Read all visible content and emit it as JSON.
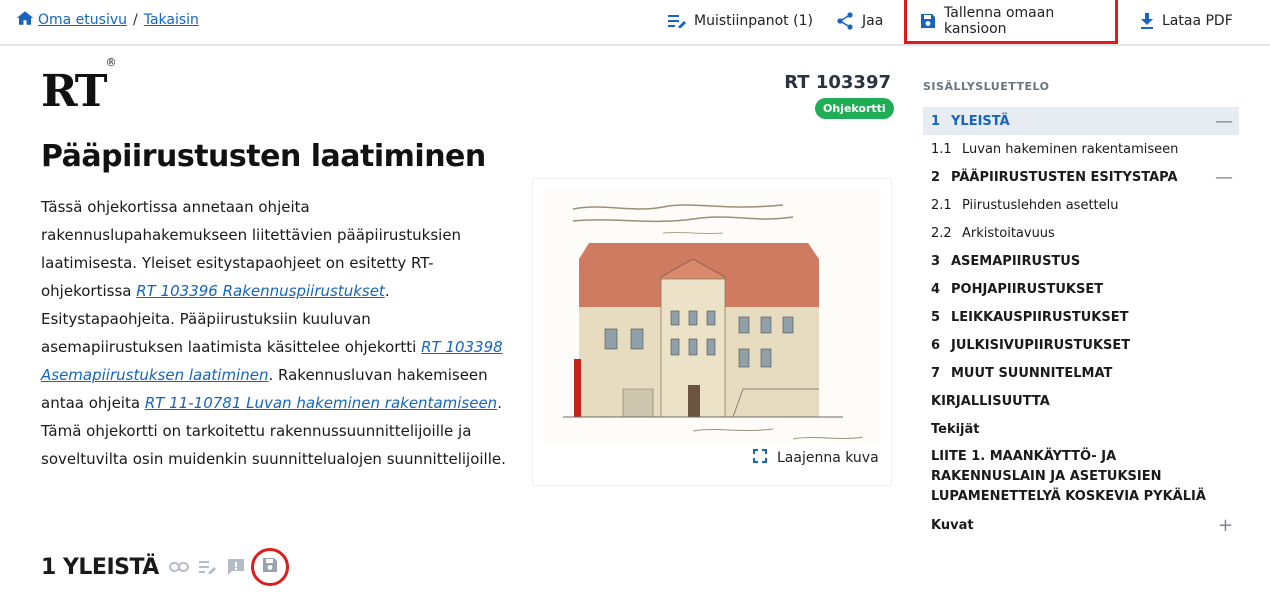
{
  "breadcrumb": {
    "home_label": "Oma etusivu",
    "separator": "/",
    "back_label": "Takaisin"
  },
  "toolbar": {
    "notes_label": "Muistiinpanot (1)",
    "share_label": "Jaa",
    "save_label": "Tallenna omaan kansioon",
    "pdf_label": "Lataa PDF"
  },
  "document": {
    "logo_text": "RT",
    "logo_mark": "®",
    "number": "RT 103397",
    "badge": "Ohjekortti",
    "title": "Pääpiirustusten laatiminen",
    "intro": [
      {
        "text": "Tässä ohjekortissa annetaan ohjeita rakennuslupahakemukseen liitettävien pääpiirustuksien laatimisesta. Yleiset esitystapaohjeet on esitetty RT-ohjekortissa "
      },
      {
        "link": "RT 103396 Rakennuspiirustukset"
      },
      {
        "text": ". Esitystapaohjeita. Pääpiirustuksiin kuuluvan asemapiirustuksen laatimista käsittelee ohjekortti "
      },
      {
        "link": "RT 103398 Asemapiirustuksen laatiminen"
      },
      {
        "text": ". Rakennusluvan hakemiseen antaa ohjeita "
      },
      {
        "link": "RT 11-10781 Luvan hakeminen rakentamiseen"
      },
      {
        "text": ". Tämä ohjekortti on tarkoitettu rakennussuunnittelijoille ja soveltuvilta osin muidenkin suunnittelualojen suunnittelijoille."
      }
    ],
    "expand_image_label": "Laajenna kuva",
    "section1_title": "1 YLEISTÄ"
  },
  "toc": {
    "heading": "SISÄLLYSLUETTELO",
    "items": [
      {
        "num": "1",
        "label": "YLEISTÄ",
        "level": 1,
        "active": true,
        "control": "—"
      },
      {
        "num": "1.1",
        "label": "Luvan hakeminen rakentamiseen",
        "level": 2
      },
      {
        "num": "2",
        "label": "PÄÄPIIRUSTUSTEN ESITYSTAPA",
        "level": 1,
        "control": "—"
      },
      {
        "num": "2.1",
        "label": "Piirustuslehden asettelu",
        "level": 2
      },
      {
        "num": "2.2",
        "label": "Arkistoitavuus",
        "level": 2
      },
      {
        "num": "3",
        "label": "ASEMAPIIRUSTUS",
        "level": 1
      },
      {
        "num": "4",
        "label": "POHJAPIIRUSTUKSET",
        "level": 1
      },
      {
        "num": "5",
        "label": "LEIKKAUSPIIRUSTUKSET",
        "level": 1
      },
      {
        "num": "6",
        "label": "JULKISIVUPIIRUSTUKSET",
        "level": 1
      },
      {
        "num": "7",
        "label": "MUUT SUUNNITELMAT",
        "level": 1
      },
      {
        "num": "",
        "label": "KIRJALLISUUTTA",
        "level": 1
      },
      {
        "num": "",
        "label": "Tekijät",
        "level": 1
      },
      {
        "num": "",
        "label": "LIITE 1. MAANKÄYTTÖ- JA RAKENNUSLAIN JA ASETUKSIEN LUPAMENETTELYÄ KOSKEVIA PYKÄLIÄ",
        "level": 1,
        "multi": true
      },
      {
        "num": "",
        "label": "Kuvat",
        "level": 1,
        "control": "+"
      }
    ]
  },
  "colors": {
    "accent": "#1565c0",
    "badge": "#1fae55",
    "highlight": "#e01b1b"
  }
}
